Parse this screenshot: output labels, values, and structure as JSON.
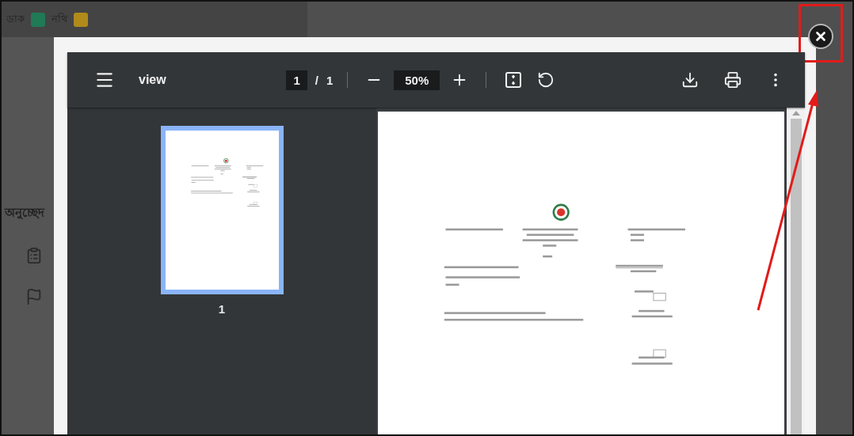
{
  "background_app": {
    "nav_items": [
      {
        "label": "ডাক",
        "color": "#1f7a55"
      },
      {
        "label": "নথি",
        "color": "#b08a1a"
      }
    ],
    "section_heading": "অনুচ্ছেদ"
  },
  "viewer": {
    "title": "view",
    "page_input": "1",
    "page_separator": "/",
    "page_total": "1",
    "zoom": "50%",
    "thumbnails": [
      {
        "label": "1",
        "selected": true
      }
    ]
  }
}
